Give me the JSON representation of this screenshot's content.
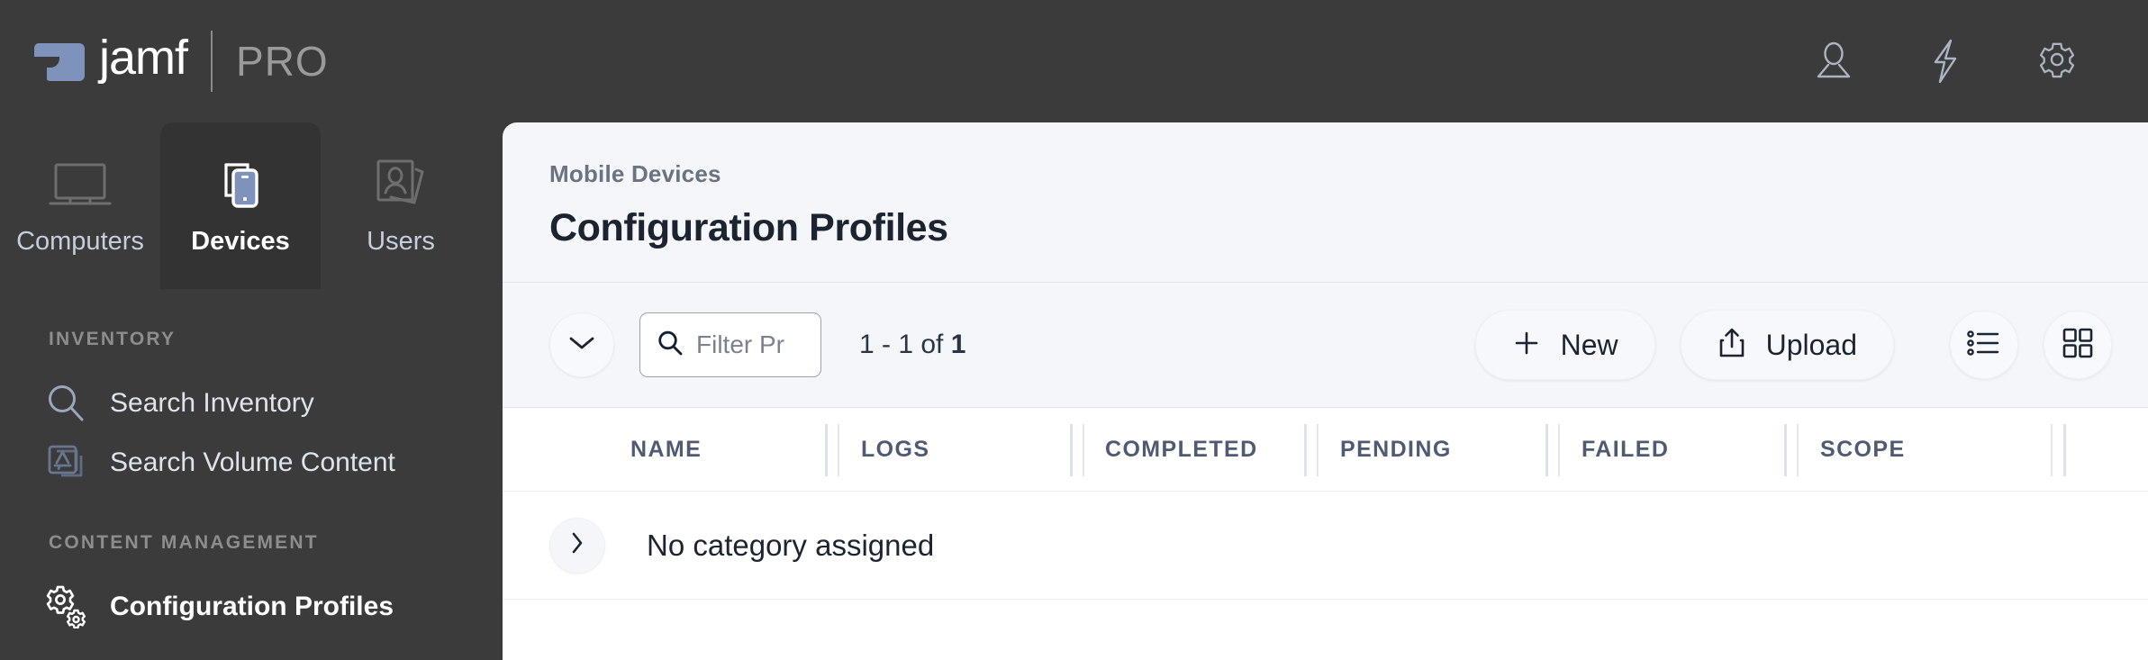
{
  "brand": {
    "name": "jamf",
    "edition": "PRO"
  },
  "topbar": {
    "icons": [
      {
        "name": "user-icon",
        "label": "Account"
      },
      {
        "name": "lightning-icon",
        "label": "Quick Actions"
      },
      {
        "name": "gear-icon",
        "label": "Settings"
      }
    ]
  },
  "tabs": [
    {
      "id": "computers",
      "label": "Computers",
      "icon": "laptop-icon",
      "active": false
    },
    {
      "id": "devices",
      "label": "Devices",
      "icon": "mobile-devices-icon",
      "active": true
    },
    {
      "id": "users",
      "label": "Users",
      "icon": "users-cards-icon",
      "active": false
    }
  ],
  "sidebar": {
    "sections": [
      {
        "title": "INVENTORY",
        "items": [
          {
            "label": "Search Inventory",
            "icon": "magnifier-icon",
            "active": false
          },
          {
            "label": "Search Volume Content",
            "icon": "app-store-stack-icon",
            "active": false
          }
        ]
      },
      {
        "title": "CONTENT MANAGEMENT",
        "items": [
          {
            "label": "Configuration Profiles",
            "icon": "gears-icon",
            "active": true
          }
        ]
      }
    ]
  },
  "main": {
    "breadcrumb": "Mobile Devices",
    "title": "Configuration Profiles"
  },
  "toolbar": {
    "collapse_icon": "chevron-down-icon",
    "filter_placeholder": "Filter Pr",
    "count_prefix": "1 - 1 of ",
    "count_total": "1",
    "new_label": "New",
    "new_icon": "plus-icon",
    "upload_label": "Upload",
    "upload_icon": "upload-icon",
    "list_view_icon": "list-view-icon",
    "grid_view_icon": "grid-view-icon"
  },
  "table": {
    "columns": [
      "NAME",
      "LOGS",
      "COMPLETED",
      "PENDING",
      "FAILED",
      "SCOPE"
    ],
    "rows": [
      {
        "expand_icon": "chevron-right-icon",
        "label": "No category assigned"
      }
    ]
  },
  "colors": {
    "chrome_dark": "#3b3b3b",
    "tab_active": "#333333",
    "brand_blue": "#7e93bb",
    "panel_bg": "#f4f6f9",
    "table_bg": "#ffffff",
    "header_text": "#4e5b72"
  }
}
